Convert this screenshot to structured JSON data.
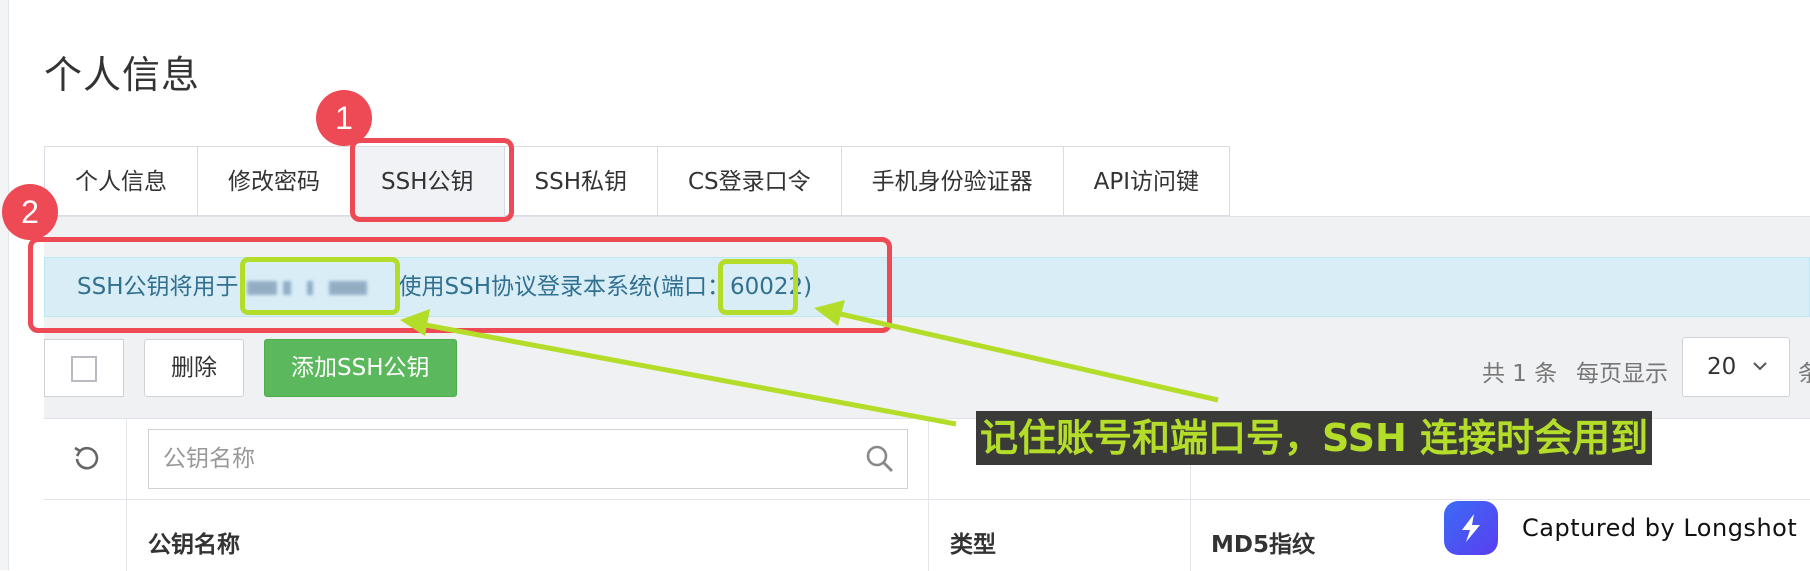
{
  "page": {
    "title": "个人信息"
  },
  "tabs": [
    {
      "label": "个人信息"
    },
    {
      "label": "修改密码"
    },
    {
      "label": "SSH公钥",
      "active": true
    },
    {
      "label": "SSH私钥"
    },
    {
      "label": "CS登录口令"
    },
    {
      "label": "手机身份验证器"
    },
    {
      "label": "API访问键"
    }
  ],
  "info": {
    "prefix": "SSH公钥将用于",
    "middle": "使用SSH协议登录本系统(端口：",
    "port": "60022",
    "suffix": ")"
  },
  "toolbar": {
    "delete_label": "删除",
    "add_label": "添加SSH公钥"
  },
  "pager": {
    "total": "共 1 条",
    "per_page_label": "每页显示",
    "per_page_value": "20",
    "unit_partial": "条"
  },
  "table": {
    "search_placeholder": "公钥名称",
    "columns": [
      "公钥名称",
      "类型",
      "MD5指纹"
    ]
  },
  "annotations": {
    "step1": "1",
    "step2": "2",
    "callout": "记住账号和端口号，SSH 连接时会用到",
    "highlight_color": "#b4dd2a",
    "marker_color": "#ee4a55"
  },
  "watermark": {
    "text": "Captured by Longshot"
  },
  "colors": {
    "info_bg": "#d9edf7",
    "info_text": "#31708f",
    "primary_green": "#5cb85c"
  }
}
